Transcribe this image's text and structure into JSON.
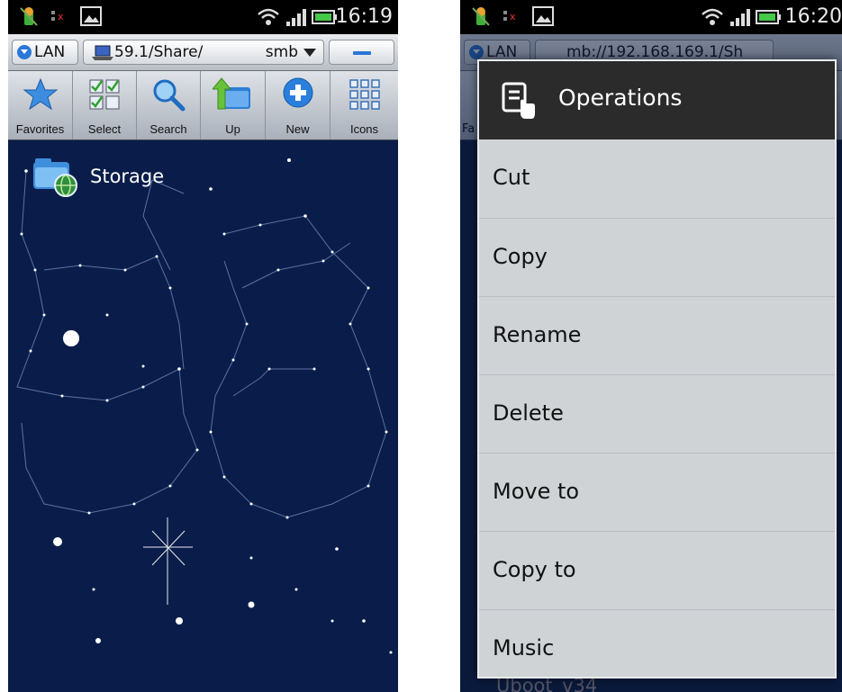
{
  "left_screen": {
    "status": {
      "time": "16:19"
    },
    "address": {
      "lan_label": "LAN",
      "path": "59.1/Share/",
      "protocol": "smb"
    },
    "toolbar": {
      "items": [
        {
          "label": "Favorites",
          "icon": "star-icon"
        },
        {
          "label": "Select",
          "icon": "checklist-icon"
        },
        {
          "label": "Search",
          "icon": "magnifier-icon"
        },
        {
          "label": "Up",
          "icon": "folder-up-icon"
        },
        {
          "label": "New",
          "icon": "plus-circle-icon"
        },
        {
          "label": "Icons",
          "icon": "grid-icon"
        }
      ]
    },
    "files": [
      {
        "name": "Storage",
        "icon": "network-folder-icon"
      }
    ]
  },
  "right_screen": {
    "status": {
      "time": "16:20"
    },
    "address": {
      "lan_label": "LAN",
      "path": "mb://192.168.169.1/Sh"
    },
    "toolbar_partial": "Fa",
    "menu": {
      "title": "Operations",
      "items": [
        "Cut",
        "Copy",
        "Rename",
        "Delete",
        "Move to",
        "Copy to",
        "Music"
      ]
    },
    "behind_text": "Uboot_v34"
  },
  "colors": {
    "background": "#0a1d4a",
    "accent": "#2a77d8",
    "menu_bg": "#cfd3d6",
    "menu_header": "#2b2b2b"
  }
}
